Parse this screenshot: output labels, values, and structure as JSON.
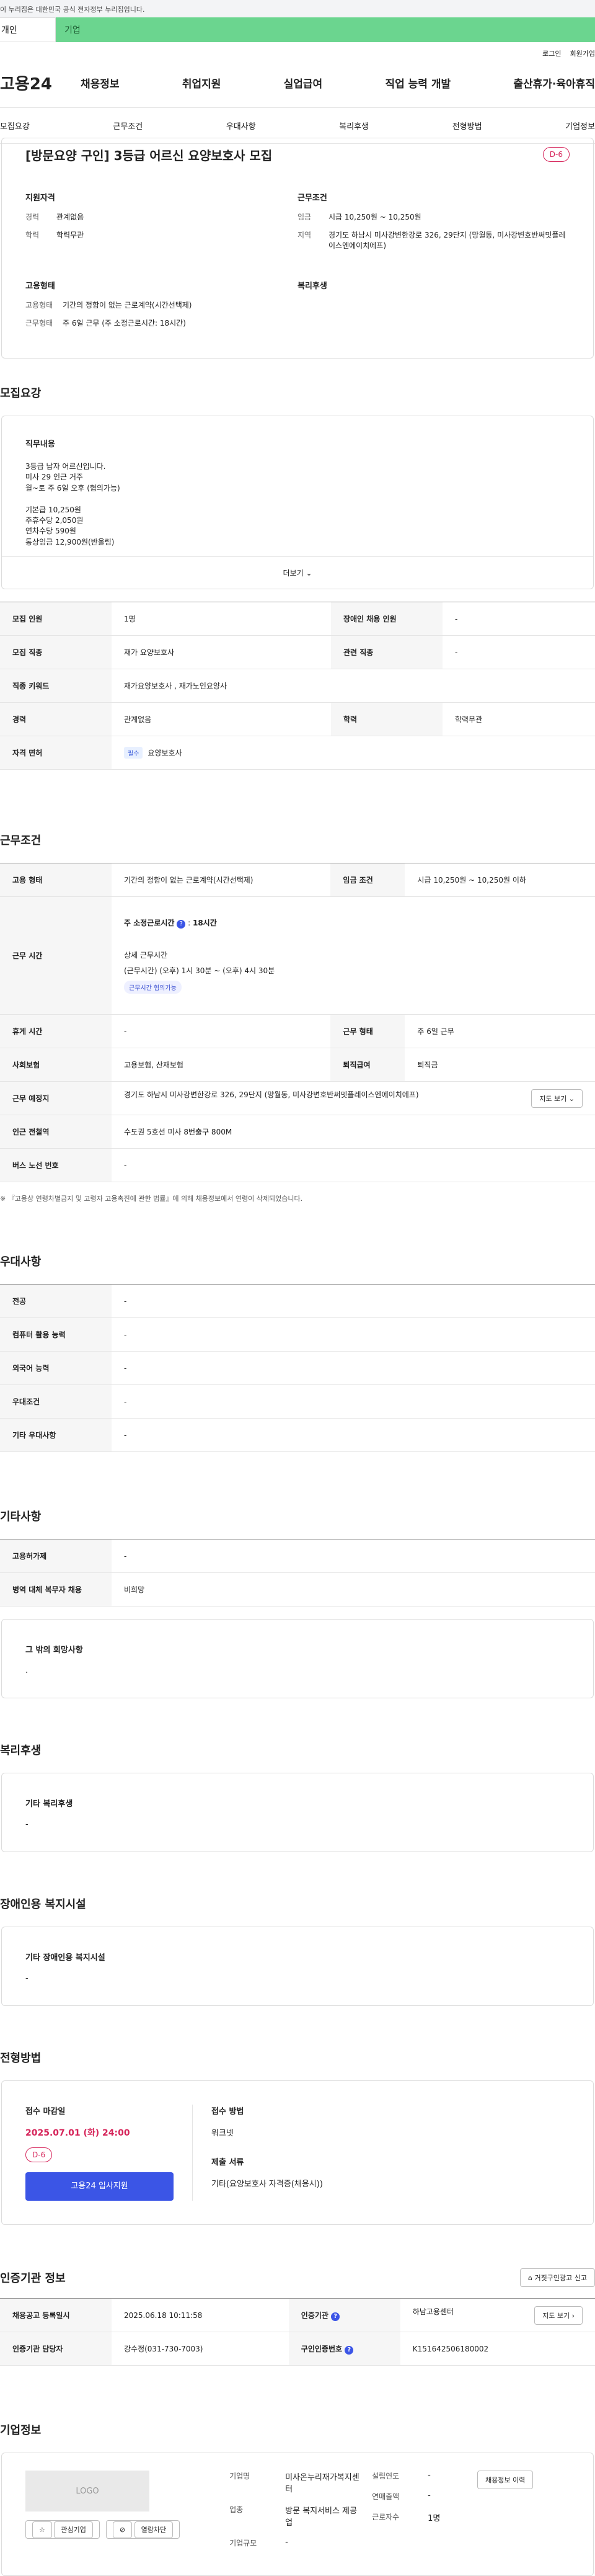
{
  "gov_banner": "이 누리집은 대한민국 공식 전자정부 누리집입니다.",
  "user_tabs": [
    "개인",
    "기업"
  ],
  "top_links": [
    "로그인",
    "회원가입"
  ],
  "logo": "고용24",
  "gnb": [
    "채용정보",
    "취업지원",
    "실업급여",
    "직업 능력 개발",
    "출산휴가·육아휴직"
  ],
  "detail_tabs": [
    "모집요강",
    "근무조건",
    "우대사항",
    "복리후생",
    "전형방법",
    "기업정보"
  ],
  "header": {
    "title": "[방문요양 구인] 3등급 어르신 요양보호사 모집",
    "dday": "D-6",
    "qual_title": "지원자격",
    "career_label": "경력",
    "career_value": "관계없음",
    "edu_label": "학력",
    "edu_value": "학력무관",
    "cond_title": "근무조건",
    "wage_label": "임금",
    "wage_value": "시급 10,250원 ~ 10,250원",
    "region_label": "지역",
    "region_value": "경기도 하남시 미사강변한강로 326, 29단지 (망월동, 미사강변호반써밋플레이스엔에이치에프)",
    "emp_title": "고용형태",
    "emptype_label": "고용형태",
    "emptype_value": "기간의 정함이 없는 근로계약(시간선택제)",
    "worktype_label": "근무형태",
    "worktype_value": "주 6일 근무 (주 소정근로시간: 18시간)",
    "welfare_title": "복리후생"
  },
  "recruit": {
    "section_title": "모집요강",
    "desc_title": "직무내용",
    "desc_text": "3등급 남자 어르신입니다.\n미사 29 인근 거주\n월~토 주 6일 오후 (협의가능)\n\n기본급 10,250원\n주휴수당 2,050원\n연차수당 590원\n통상임금 12,900원(반올림)",
    "more": "더보기",
    "rows": [
      {
        "k1": "모집 인원",
        "v1": "1명",
        "k2": "장애인 채용 인원",
        "v2": "-"
      },
      {
        "k1": "모집 직종",
        "v1": "재가 요양보호사",
        "k2": "관련 직종",
        "v2": "-"
      },
      {
        "k1": "직종 키워드",
        "v1": "재가요양보호사 , 재가노인요양사"
      },
      {
        "k1": "경력",
        "v1": "관계없음",
        "k2": "학력",
        "v2": "학력무관"
      },
      {
        "k1": "자격 면허",
        "badge": "필수",
        "v1": "요양보호사"
      }
    ]
  },
  "conditions": {
    "section_title": "근무조건",
    "emp_label": "고용 형태",
    "emp_value": "기간의 정함이 없는 근로계약(시간선택제)",
    "wage_label": "임금 조건",
    "wage_value": "시급 10,250원 ~ 10,250원 이하",
    "time_label": "근무 시간",
    "time_week": "주 소정근로시간",
    "time_week_value": "18시간",
    "time_detail_title": "상세 근무시간",
    "time_detail": "(근무시간) (오후) 1시 30분 ~ (오후) 4시 30분",
    "time_pill": "근무시간 협의가능",
    "rest_label": "휴게 시간",
    "rest_value": "-",
    "worktype_label": "근무 형태",
    "worktype_value": "주 6일 근무",
    "insurance_label": "사회보험",
    "insurance_value": "고용보험, 산재보험",
    "retire_label": "퇴직급여",
    "retire_value": "퇴직금",
    "place_label": "근무 예정지",
    "place_value": "경기도 하남시 미사강변한강로 326, 29단지 (망월동, 미사강변호반써밋플레이스엔에이치에프)",
    "map_btn": "지도 보기",
    "subway_label": "인근 전철역",
    "subway_value": "수도권 5호선 미사 8번출구 800M",
    "bus_label": "버스 노선 번호",
    "bus_value": "-",
    "note": "※ 『고용상 연령차별금지 및 고령자 고용촉진에 관한 법률』에 의해 채용정보에서 연령이 삭제되었습니다."
  },
  "preference": {
    "section_title": "우대사항",
    "rows": [
      {
        "k": "전공",
        "v": "-"
      },
      {
        "k": "컴퓨터 활용 능력",
        "v": "-"
      },
      {
        "k": "외국어 능력",
        "v": "-"
      },
      {
        "k": "우대조건",
        "v": "-"
      },
      {
        "k": "기타 우대사항",
        "v": "-"
      }
    ]
  },
  "etc": {
    "section_title": "기타사항",
    "rows": [
      {
        "k": "고용허가제",
        "v": "-"
      },
      {
        "k": "병역 대체 복무자 채용",
        "v": "비희망"
      }
    ],
    "box_title": "그 밖의 희망사항",
    "box_value": "."
  },
  "welfare": {
    "section_title": "복리후생",
    "box_title": "기타 복리후생",
    "box_value": "-"
  },
  "disabled": {
    "section_title": "장애인용 복지시설",
    "box_title": "기타 장애인용 복지시설",
    "box_value": "-"
  },
  "apply": {
    "section_title": "전형방법",
    "deadline_title": "접수 마감일",
    "deadline": "2025.07.01 (화) 24:00",
    "dday": "D-6",
    "apply_btn": "고용24 입사지원",
    "method_title": "접수 방법",
    "method_value": "워크넷",
    "docs_title": "제출 서류",
    "docs_value": "기타(요양보호사 자격증(채용시))"
  },
  "agency": {
    "section_title": "인증기관 정보",
    "report_btn": "거짓구인광고 신고",
    "reg_label": "채용공고 등록일시",
    "reg_value": "2025.06.18 10:11:58",
    "org_label": "인증기관",
    "org_value": "하남고용센터",
    "map_btn": "지도 보기",
    "manager_label": "인증기관 담당자",
    "manager_value": "강수정(031-730-7003)",
    "num_label": "구인인증번호",
    "num_value": "K151642506180002"
  },
  "company": {
    "section_title": "기업정보",
    "logo": "LOGO",
    "fav_btn": "관심기업",
    "block_btn": "열람차단",
    "name_label": "기업명",
    "name_value": "미사온누리재가복지센터",
    "type_label": "업종",
    "type_value": "방문 복지서비스 제공업",
    "size_label": "기업규모",
    "size_value": "-",
    "year_label": "설립연도",
    "year_value": "-",
    "sales_label": "연매출액",
    "sales_value": "-",
    "staff_label": "근로자수",
    "staff_value": "1명",
    "history_btn": "채용정보 이력"
  }
}
